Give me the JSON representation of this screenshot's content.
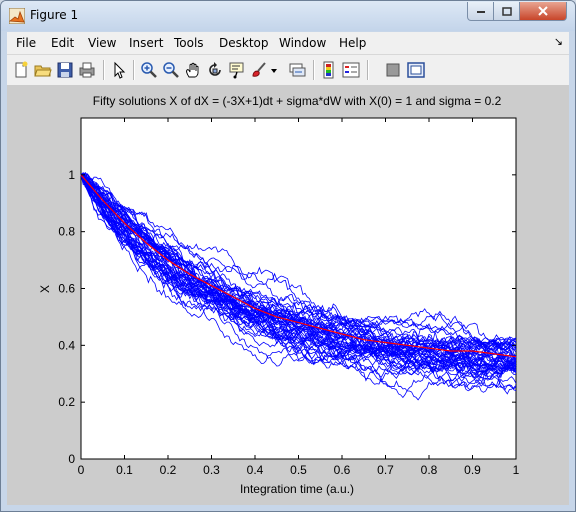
{
  "window": {
    "title": "Figure 1"
  },
  "menu": [
    "File",
    "Edit",
    "View",
    "Insert",
    "Tools",
    "Desktop",
    "Window",
    "Help"
  ],
  "toolbar": {
    "icons": [
      "new-figure-icon",
      "open-file-icon",
      "save-icon",
      "print-icon",
      "edit-plot-arrow-icon",
      "zoom-in-icon",
      "zoom-out-icon",
      "pan-hand-icon",
      "rotate-3d-icon",
      "data-cursor-icon",
      "brush-icon",
      "brush-dropdown-icon",
      "link-plot-icon",
      "insert-colorbar-icon",
      "insert-legend-icon",
      "hide-plot-tools-icon",
      "show-plot-tools-icon"
    ]
  },
  "colors": {
    "paths": "#0000ff",
    "mean": "#ff0000",
    "figure_bg": "#cccccc",
    "axes_bg": "#ffffff"
  },
  "chart_data": {
    "type": "line",
    "title": "Fifty solutions X of dX = (-3X+1)dt + sigma*dW with X(0) = 1 and sigma = 0.2",
    "xlabel": "Integration time (a.u.)",
    "ylabel": "X",
    "xlim": [
      0,
      1
    ],
    "ylim": [
      0,
      1.2
    ],
    "xticks": [
      "0",
      "0.1",
      "0.2",
      "0.3",
      "0.4",
      "0.5",
      "0.6",
      "0.7",
      "0.8",
      "0.9",
      "1"
    ],
    "yticks": [
      "0",
      "0.2",
      "0.4",
      "0.6",
      "0.8",
      "1"
    ],
    "grid": false,
    "series": [
      {
        "color": "#ff0000",
        "x": [
          0,
          0.05,
          0.1,
          0.15,
          0.2,
          0.25,
          0.3,
          0.35,
          0.4,
          0.45,
          0.5,
          0.55,
          0.6,
          0.65,
          0.7,
          0.75,
          0.8,
          0.85,
          0.9,
          0.95,
          1
        ],
        "values": [
          1,
          0.91,
          0.83,
          0.76,
          0.7,
          0.65,
          0.61,
          0.57,
          0.53,
          0.5,
          0.48,
          0.46,
          0.44,
          0.42,
          0.41,
          0.4,
          0.39,
          0.38,
          0.38,
          0.37,
          0.36
        ]
      },
      {
        "color": "#0000ff",
        "count": 50,
        "x": [
          0,
          0.1,
          0.2,
          0.3,
          0.4,
          0.5,
          0.6,
          0.7,
          0.8,
          0.9,
          1
        ],
        "values_band_low": [
          0.95,
          0.75,
          0.6,
          0.48,
          0.4,
          0.34,
          0.3,
          0.24,
          0.24,
          0.25,
          0.2
        ],
        "values_band_high": [
          1.02,
          0.9,
          0.82,
          0.74,
          0.68,
          0.6,
          0.62,
          0.64,
          0.66,
          0.6,
          0.58
        ]
      }
    ]
  }
}
